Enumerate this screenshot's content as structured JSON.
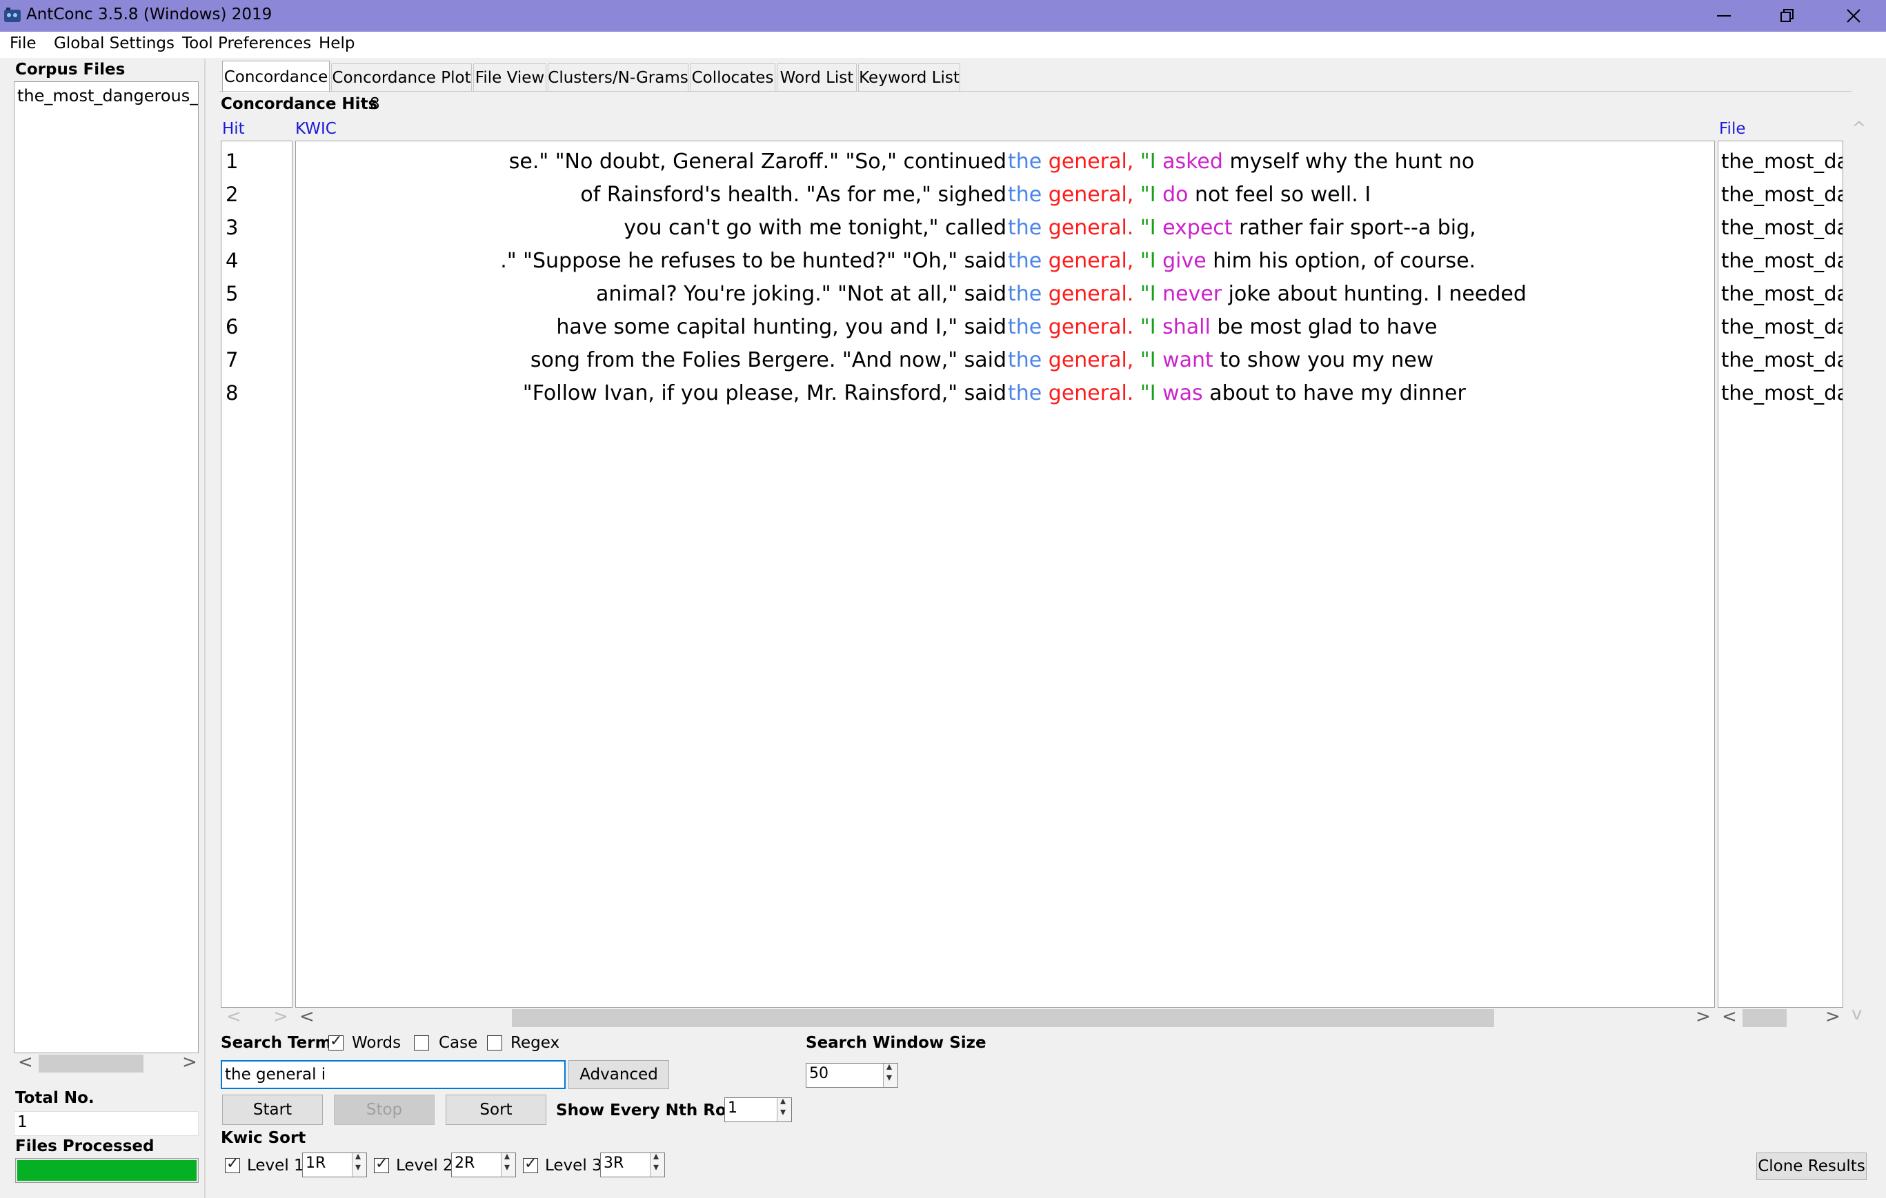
{
  "window": {
    "title": "AntConc 3.5.8 (Windows) 2019",
    "controls": {
      "minimize": "—",
      "restore": "❐",
      "close": "✕"
    }
  },
  "menu": [
    "File",
    "Global Settings",
    "Tool Preferences",
    "Help"
  ],
  "left_panel": {
    "corpus_files_label": "Corpus Files",
    "files": [
      "the_most_dangerous_g"
    ],
    "total_no_label": "Total No.",
    "total_no": "1",
    "files_processed_label": "Files Processed",
    "files_processed_progress": 1.0
  },
  "tabs": [
    "Concordance",
    "Concordance Plot",
    "File View",
    "Clusters/N-Grams",
    "Collocates",
    "Word List",
    "Keyword List"
  ],
  "active_tab": "Concordance",
  "results": {
    "hits_label": "Concordance Hits",
    "hits_count": "8",
    "columns": {
      "hit": "Hit",
      "kwic": "KWIC",
      "file": "File"
    },
    "rows": [
      {
        "n": "1",
        "left": "se.\"  \"No doubt, General Zaroff.\" \"So,\" continued",
        "node1": "the",
        "node2": "general,",
        "node3": "\"I",
        "next": "asked",
        "rest": "myself why the hunt no",
        "file": "the_most_da"
      },
      {
        "n": "2",
        "left": "of Rainsford's health. \"As for me,\" sighed",
        "node1": "the",
        "node2": "general,",
        "node3": "\"I",
        "next": "do",
        "rest": "not feel so well. I",
        "file": "the_most_da"
      },
      {
        "n": "3",
        "left": "you can't go with me tonight,\" called",
        "node1": "the",
        "node2": "general.",
        "node3": "\"I",
        "next": "expect",
        "rest": "rather fair sport--a big,",
        "file": "the_most_da"
      },
      {
        "n": "4",
        "left": ".\" \"Suppose he refuses to be hunted?\" \"Oh,\" said",
        "node1": "the",
        "node2": "general,",
        "node3": "\"I",
        "next": "give",
        "rest": "him his option, of course.",
        "file": "the_most_da"
      },
      {
        "n": "5",
        "left": "animal? You're joking.\" \"Not at all,\" said",
        "node1": "the",
        "node2": "general.",
        "node3": "\"I",
        "next": "never",
        "rest": "joke about hunting. I needed",
        "file": "the_most_da"
      },
      {
        "n": "6",
        "left": "have some capital hunting, you and I,\" said",
        "node1": "the",
        "node2": "general.",
        "node3": "\"I",
        "next": "shall",
        "rest": "be most glad to have",
        "file": "the_most_da"
      },
      {
        "n": "7",
        "left": "song from the Folies Bergere. \"And now,\" said",
        "node1": "the",
        "node2": "general,",
        "node3": "\"I",
        "next": "want",
        "rest": "to show you my new",
        "file": "the_most_da"
      },
      {
        "n": "8",
        "left": "\"Follow Ivan, if you please, Mr. Rainsford,\" said",
        "node1": "the",
        "node2": "general.",
        "node3": "\"I",
        "next": "was",
        "rest": "about to have my dinner",
        "file": "the_most_da"
      }
    ]
  },
  "search": {
    "search_term_label": "Search Term",
    "words_label": "Words",
    "words_checked": true,
    "case_label": "Case",
    "case_checked": false,
    "regex_label": "Regex",
    "regex_checked": false,
    "value": "the general i",
    "advanced_label": "Advanced",
    "window_size_label": "Search Window Size",
    "window_size": "50",
    "start_label": "Start",
    "stop_label": "Stop",
    "sort_label": "Sort",
    "nth_row_label": "Show Every Nth Row",
    "nth_row": "1",
    "kwic_sort_label": "Kwic Sort",
    "levels": [
      {
        "label": "Level 1",
        "value": "1R",
        "checked": true
      },
      {
        "label": "Level 2",
        "value": "2R",
        "checked": true
      },
      {
        "label": "Level 3",
        "value": "3R",
        "checked": true
      }
    ],
    "clone_label": "Clone Results"
  },
  "colors": {
    "titlebar": "#8c87d6",
    "node_the": "#4a86e8",
    "node_general": "#ff1a1a",
    "node_i": "#18a018",
    "next_word": "#cc22cc",
    "column_header": "#1a1ad8",
    "progress_fill": "#06b025"
  },
  "scroll_arrows": {
    "left": "<",
    "right": ">",
    "up": "^",
    "down": "v"
  }
}
